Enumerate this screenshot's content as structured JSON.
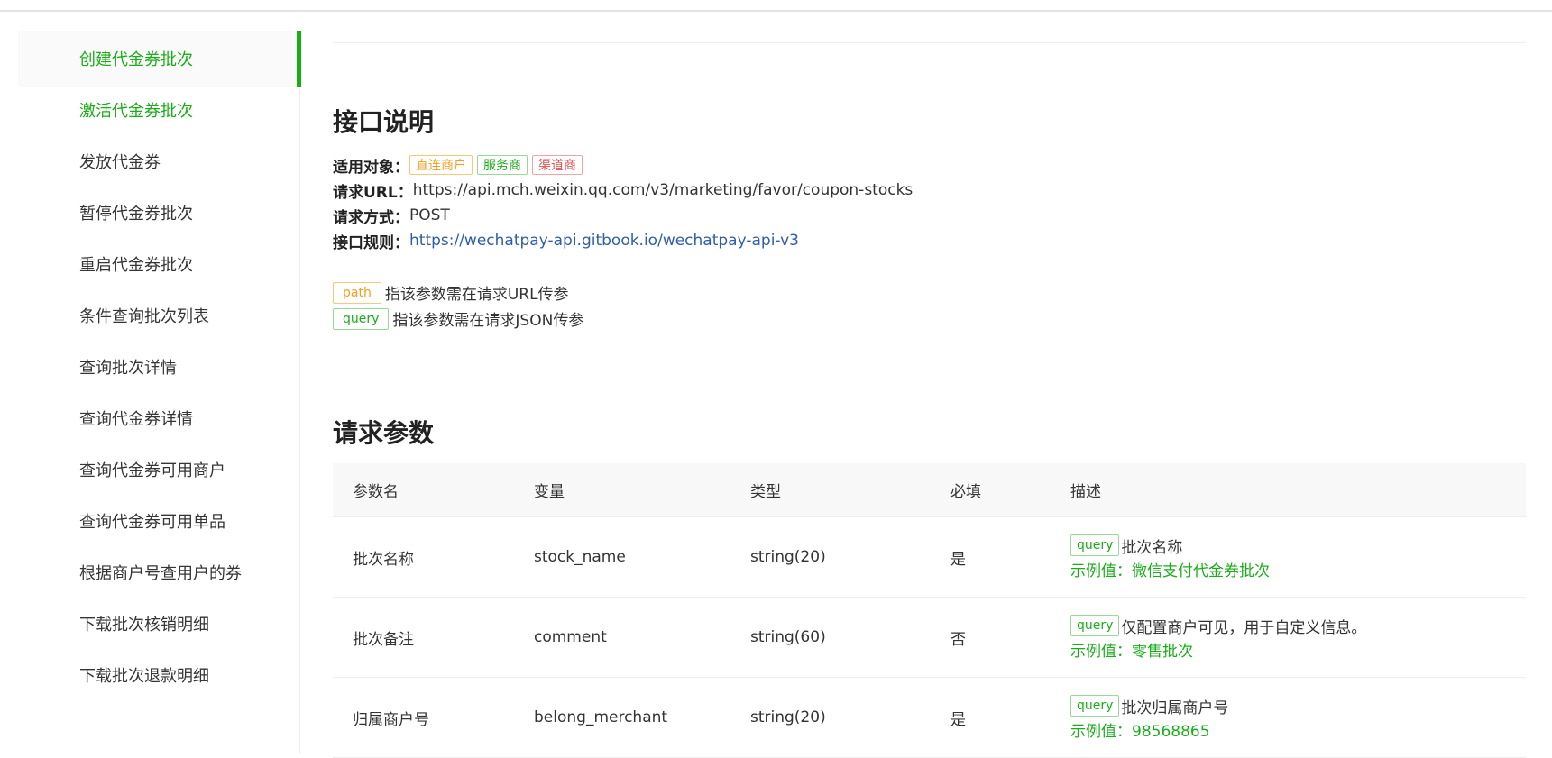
{
  "sidebar": {
    "items": [
      {
        "label": "创建代金券批次",
        "state": "active"
      },
      {
        "label": "激活代金券批次",
        "state": "highlight"
      },
      {
        "label": "发放代金券",
        "state": "normal"
      },
      {
        "label": "暂停代金券批次",
        "state": "normal"
      },
      {
        "label": "重启代金券批次",
        "state": "normal"
      },
      {
        "label": "条件查询批次列表",
        "state": "normal"
      },
      {
        "label": "查询批次详情",
        "state": "normal"
      },
      {
        "label": "查询代金券详情",
        "state": "normal"
      },
      {
        "label": "查询代金券可用商户",
        "state": "normal"
      },
      {
        "label": "查询代金券可用单品",
        "state": "normal"
      },
      {
        "label": "根据商户号查用户的券",
        "state": "normal"
      },
      {
        "label": "下载批次核销明细",
        "state": "normal"
      },
      {
        "label": "下载批次退款明细",
        "state": "normal"
      }
    ]
  },
  "interface": {
    "title": "接口说明",
    "target_label": "适用对象：",
    "target_tags": [
      {
        "text": "直连商户",
        "color": "#f0a020"
      },
      {
        "text": "服务商",
        "color": "#1aad19"
      },
      {
        "text": "渠道商",
        "color": "#e05050"
      }
    ],
    "url_label": "请求URL：",
    "url_value": "https://api.mch.weixin.qq.com/v3/marketing/favor/coupon-stocks",
    "method_label": "请求方式：",
    "method_value": "POST",
    "rule_label": "接口规则：",
    "rule_link": "https://wechatpay-api.gitbook.io/wechatpay-api-v3"
  },
  "legend": {
    "path_tag": "path",
    "path_text": "指该参数需在请求URL传参",
    "query_tag": "query",
    "query_text": "指该参数需在请求JSON传参"
  },
  "params": {
    "title": "请求参数",
    "columns": [
      "参数名",
      "变量",
      "类型",
      "必填",
      "描述"
    ],
    "rows": [
      {
        "name": "批次名称",
        "var": "stock_name",
        "type": "string(20)",
        "required": "是",
        "tag": "query",
        "desc": "批次名称",
        "example": "示例值：微信支付代金券批次"
      },
      {
        "name": "批次备注",
        "var": "comment",
        "type": "string(60)",
        "required": "否",
        "tag": "query",
        "desc": "仅配置商户可见，用于自定义信息。",
        "example": "示例值：零售批次"
      },
      {
        "name": "归属商户号",
        "var": "belong_merchant",
        "type": "string(20)",
        "required": "是",
        "tag": "query",
        "desc": "批次归属商户号",
        "example": "示例值：98568865"
      }
    ]
  },
  "colors": {
    "accent": "#1aad19",
    "link": "#2f5ea8",
    "orange": "#f0a020",
    "red": "#e05050"
  }
}
